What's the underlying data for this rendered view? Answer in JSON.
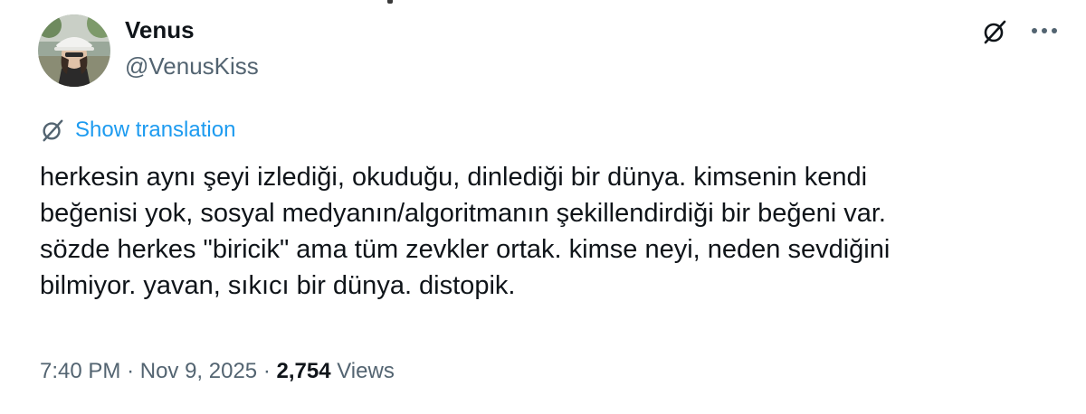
{
  "author": {
    "display_name": "Venus",
    "handle": "@VenusKiss"
  },
  "actions": {
    "grok_icon": "grok-slash-circle-icon",
    "more_icon": "more-horizontal-icon"
  },
  "translation": {
    "label": "Show translation",
    "icon": "grok-slash-circle-icon"
  },
  "tweet": {
    "text_lines": [
      "herkesin aynı şeyi izlediği, okuduğu, dinlediği bir dünya. kimsenin kendi",
      "beğenisi yok, sosyal medyanın/algoritmanın şekillendirdiği bir beğeni var.",
      "sözde herkes \"biricik\" ama tüm zevkler ortak. kimse neyi, neden sevdiğini",
      "bilmiyor. yavan, sıkıcı bir dünya. distopik."
    ]
  },
  "meta": {
    "time": "7:40 PM",
    "separator": "·",
    "date": "Nov 9, 2025",
    "views_count": "2,754",
    "views_label": "Views"
  },
  "colors": {
    "text_primary": "#0f1419",
    "text_secondary": "#536471",
    "link_blue": "#1d9bf0",
    "background": "#ffffff"
  }
}
